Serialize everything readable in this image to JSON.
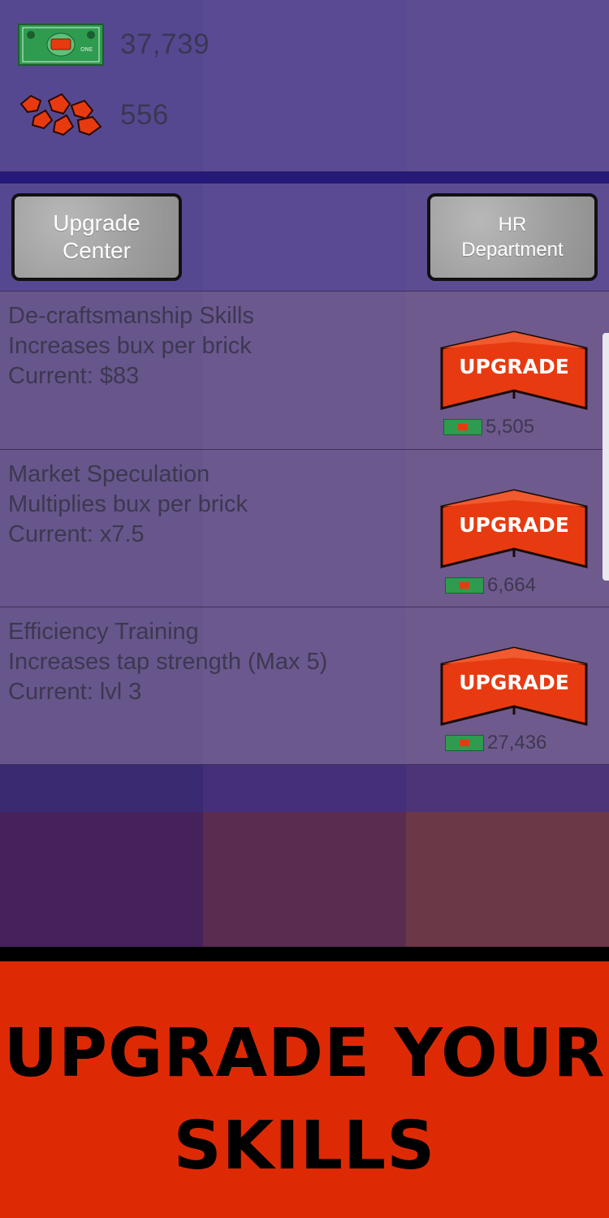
{
  "stats": {
    "bux": "37,739",
    "bricks": "556"
  },
  "icons": {
    "bux": "dollar-bill-icon",
    "bricks": "brick-chunks-icon",
    "cost": "mini-bill-icon"
  },
  "nav": {
    "upgrade_center_line1": "Upgrade",
    "upgrade_center_line2": "Center",
    "hr_line1": "HR",
    "hr_line2": "Department"
  },
  "skills": [
    {
      "title": "De-craftsmanship Skills",
      "description": "Increases bux per brick",
      "current": "Current:  $83",
      "button_label": "UPGRADE",
      "cost": "5,505"
    },
    {
      "title": "Market Speculation",
      "description": "Multiplies bux per brick",
      "current": "Current:  x7.5",
      "button_label": "UPGRADE",
      "cost": "6,664"
    },
    {
      "title": "Efficiency Training",
      "description": "Increases tap strength (Max 5)",
      "current": "Current:  lvl 3",
      "button_label": "UPGRADE",
      "cost": "27,436"
    }
  ],
  "promo": {
    "line1": "UPGRADE YOUR",
    "line2": "SKILLS"
  },
  "colors": {
    "accent_orange": "#e83a10",
    "bill_green": "#2f9b4f",
    "banner_red": "#dd2a05",
    "divider_navy": "#261a78"
  }
}
